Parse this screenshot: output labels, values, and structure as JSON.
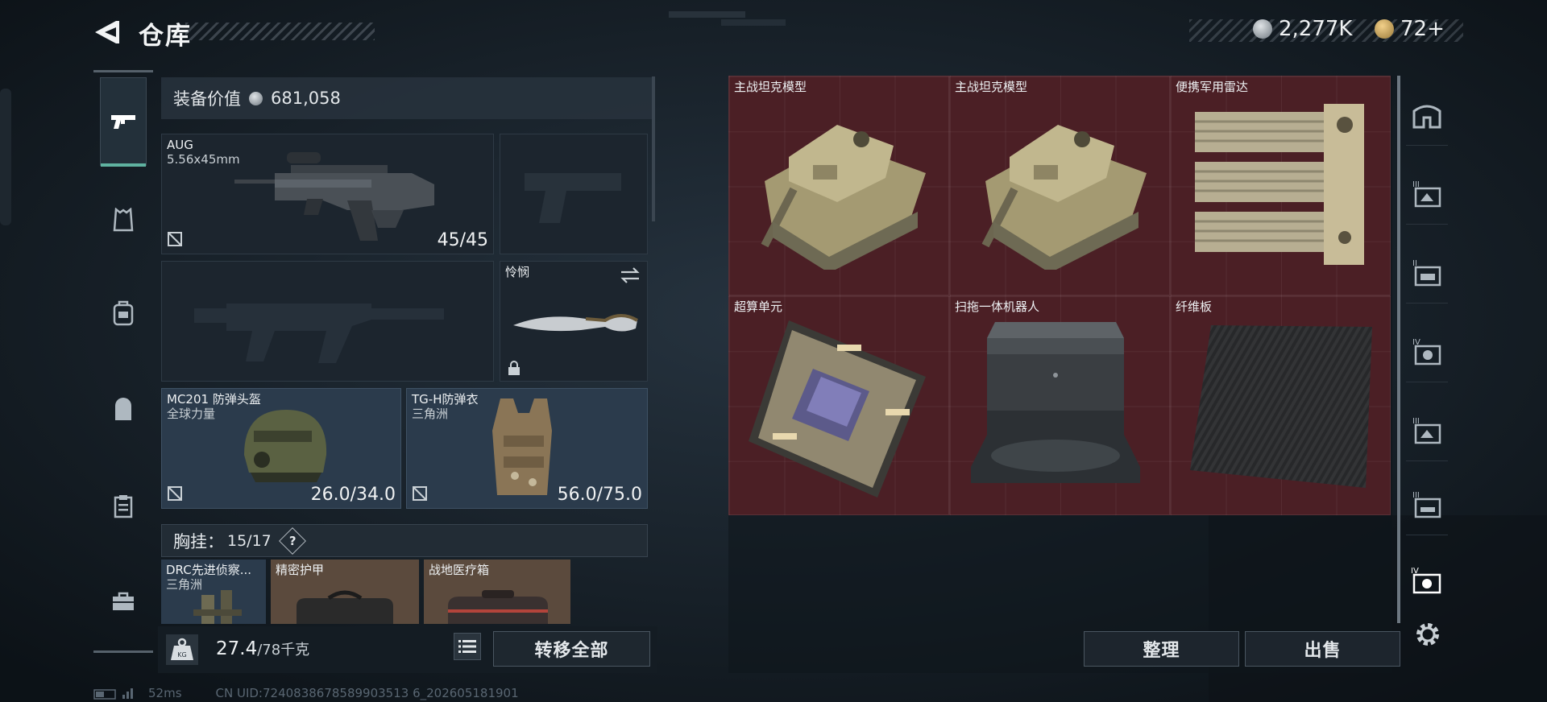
{
  "header": {
    "title": "仓库",
    "currency1": "2,277K",
    "currency2": "72+"
  },
  "equipment": {
    "value_label": "装备价值",
    "value": "681,058",
    "primary_weapon": {
      "name": "AUG",
      "caliber": "5.56x45mm",
      "ammo": "45/45"
    },
    "melee": {
      "name": "怜悯"
    },
    "helmet": {
      "name": "MC201 防弹头盔",
      "source": "全球力量",
      "durability": "26.0/34.0"
    },
    "armor": {
      "name": "TG-H防弹衣",
      "source": "三角洲",
      "durability": "56.0/75.0"
    },
    "chest_rig": {
      "label": "胸挂：",
      "capacity": "15/17",
      "help": "?"
    },
    "chest_items": [
      {
        "name": "DRC先进侦察...",
        "source": "三角洲"
      },
      {
        "name": "精密护甲",
        "source": ""
      },
      {
        "name": "战地医疗箱",
        "source": ""
      }
    ]
  },
  "weight": {
    "current": "27.4",
    "max": "/78千克"
  },
  "buttons": {
    "transfer_all": "转移全部",
    "sort": "整理",
    "sell": "出售"
  },
  "storage": {
    "items": [
      {
        "name": "主战坦克模型"
      },
      {
        "name": "主战坦克模型"
      },
      {
        "name": "便携军用雷达"
      },
      {
        "name": "超算单元"
      },
      {
        "name": "扫拖一体机器人"
      },
      {
        "name": "纤维板"
      }
    ],
    "rarity_color": "#4b1f25"
  },
  "right_tabs": [
    "home-icon",
    "container-III-icon",
    "container-II-icon",
    "container-IV-icon",
    "container-III-b-icon",
    "container-III-c-icon",
    "container-IV-active-icon",
    "gear-icon"
  ],
  "left_tabs": [
    "pistol-icon",
    "vest-icon",
    "backpack-icon",
    "pack-icon",
    "clipboard-icon",
    "toolbox-icon"
  ],
  "status": {
    "ping": "52ms",
    "uid": "CN UID:7240838678589903513 6_202605181901"
  }
}
